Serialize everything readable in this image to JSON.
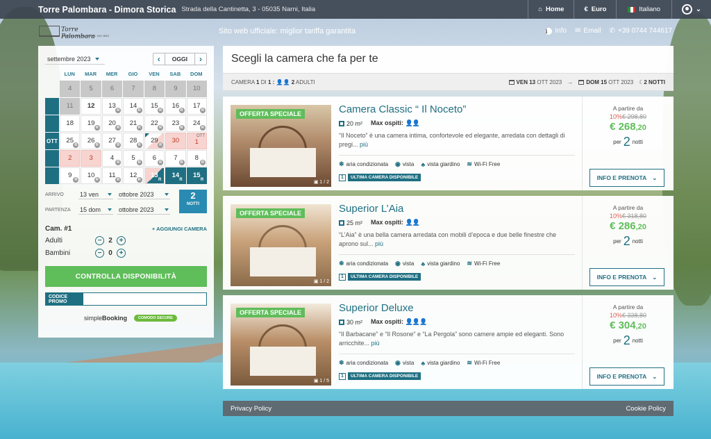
{
  "topbar": {
    "hotel_name": "Torre Palombara - Dimora Storica",
    "address": "Strada della Cantinetta, 3 - 05035 Narni, Italia",
    "home": "Home",
    "currency": "Euro",
    "language": "Italiano"
  },
  "subbar": {
    "logo_name": "Torre Palombara",
    "logo_sub": "DIMORA STORICA DEL XIII SEC",
    "tagline": "Sito web ufficiale: miglior tariffa garantita",
    "info": "Info",
    "email": "Email",
    "phone": "+39 0744 744617"
  },
  "calendar": {
    "month_label": "settembre 2023",
    "today": "OGGI",
    "prev": "‹",
    "next": "›",
    "weekdays": [
      "LUN",
      "MAR",
      "MER",
      "GIO",
      "VEN",
      "SAB",
      "DOM"
    ],
    "month_col_label": "OTT",
    "ott_tag": "OTT",
    "r_tag": "R"
  },
  "dates": {
    "arrival_label": "ARRIVO",
    "arrival_day": "13 ven",
    "arrival_month": "ottobre 2023",
    "departure_label": "PARTENZA",
    "departure_day": "15 dom",
    "departure_month": "ottobre 2023",
    "nights_num": "2",
    "nights_label": "NOTTI"
  },
  "room_select": {
    "camera_label": "Cam. #1",
    "add_room": "+ AGGIUNGI CAMERA",
    "adults_label": "Adulti",
    "adults_value": "2",
    "children_label": "Bambini",
    "children_value": "0",
    "minus": "−",
    "plus": "+"
  },
  "check_btn": "CONTROLLA DISPONIBILITÀ",
  "promo_label": "CODICE PROMO",
  "brand": {
    "simple": "simple",
    "booking": "Booking",
    "comodo": "COMODO SECURE"
  },
  "main": {
    "title": "Scegli la camera che fa per te",
    "camera_word": "CAMERA",
    "camera_num": "1",
    "di": "DI",
    "camera_total": "1 :",
    "adults": "2",
    "adults_word": "ADULTI",
    "checkin_day": "VEN",
    "checkin_date": "13",
    "checkin_rest": "OTT 2023",
    "arrow": "→",
    "checkout_day": "DOM",
    "checkout_date": "15",
    "checkout_rest": "OTT 2023",
    "nights": "2",
    "nights_word": "NOTTI"
  },
  "rooms": [
    {
      "badge": "OFFERTA SPECIALE",
      "photos": "1 / 2",
      "name": "Camera Classic “ Il Noceto”",
      "size": "20 m²",
      "guests_label": "Max ospiti:",
      "guests_icons": "👤👤",
      "desc": "“Il Noceto” è una camera intima, confortevole ed elegante, arredata con dettagli di pregi...",
      "more": "più",
      "amenities": [
        "aria condizionata",
        "vista",
        "vista giardino",
        "Wi-Fi Free"
      ],
      "last_num": "1",
      "last_txt": "ULTIMA CAMERA DISPONIBILE",
      "from": "A partire da",
      "discount": "10%",
      "old_price": "€ 298,80",
      "price_main": "€ 268",
      "price_dec": ",20",
      "per": "per",
      "nights": "2",
      "nights_word": "notti",
      "btn": "INFO E PRENOTA",
      "colors": [
        "#b08a6a",
        "#6b4a33",
        "#d8c7a8"
      ]
    },
    {
      "badge": "OFFERTA SPECIALE",
      "photos": "1 / 2",
      "name": "Superior L’Aia",
      "size": "25 m²",
      "guests_label": "Max ospiti:",
      "guests_icons": "👤👤",
      "desc": "“L’Aia” è una bella camera arredata con mobili d’epoca e due belle finestre che aprono sul...",
      "more": "più",
      "amenities": [
        "aria condizionata",
        "vista",
        "vista giardino",
        "Wi-Fi Free"
      ],
      "last_num": "1",
      "last_txt": "ULTIMA CAMERA DISPONIBILE",
      "from": "A partire da",
      "discount": "10%",
      "old_price": "€ 318,80",
      "price_main": "€ 286",
      "price_dec": ",20",
      "per": "per",
      "nights": "2",
      "nights_word": "notti",
      "btn": "INFO E PRENOTA",
      "colors": [
        "#c9a27a",
        "#8a6a4a",
        "#efe4d2"
      ]
    },
    {
      "badge": "OFFERTA SPECIALE",
      "photos": "1 / 5",
      "name": "Superior Deluxe",
      "size": "30 m²",
      "guests_label": "Max ospiti:",
      "guests_icons": "👤👤👤",
      "desc": "“Il Barbacane” e “Il Rosone” e “La Pergola” sono camere ampie ed eleganti. Sono arricchite...",
      "more": "più",
      "amenities": [
        "aria condizionata",
        "vista",
        "vista giardino",
        "Wi-Fi Free"
      ],
      "last_num": "1",
      "last_txt": "ULTIMA CAMERA DISPONIBILE",
      "from": "A partire da",
      "discount": "10%",
      "old_price": "€ 338,80",
      "price_main": "€ 304",
      "price_dec": ",20",
      "per": "per",
      "nights": "2",
      "nights_word": "notti",
      "btn": "INFO E PRENOTA",
      "colors": [
        "#b98f68",
        "#7a5a3d",
        "#f2eadc"
      ]
    }
  ],
  "footer": {
    "privacy": "Privacy Policy",
    "cookie": "Cookie Policy"
  }
}
